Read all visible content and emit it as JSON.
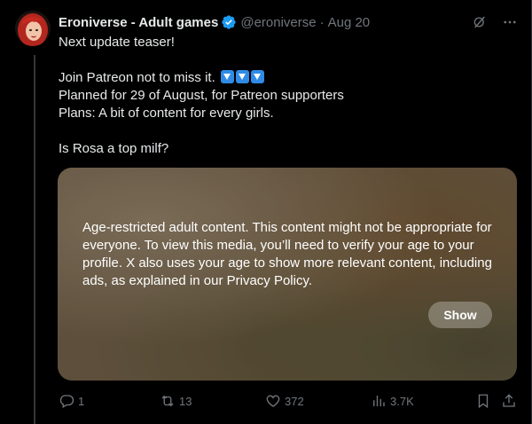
{
  "author": {
    "name": "Eroniverse - Adult games",
    "handle": "@eroniverse",
    "separator": "·",
    "date": "Aug 20"
  },
  "tweet": {
    "line1": "Next update teaser!",
    "line2": "Join Patreon not to miss it.",
    "line3": "Planned for 29 of August, for Patreon supporters",
    "line4": "Plans: A bit of content for every girls.",
    "line5": "Is Rosa a top milf?",
    "emoji": "down-arrow-button"
  },
  "media": {
    "warning": "Age-restricted adult content. This content might not be appropriate for everyone. To view this media, you’ll need to verify your age to your profile. X also uses your age to show more relevant content, including ads, as explained in our Privacy Policy.",
    "show_label": "Show"
  },
  "actions": {
    "replies": "1",
    "reposts": "13",
    "likes": "372",
    "views": "3.7K"
  },
  "colors": {
    "background": "#000000",
    "text": "#e7e9ea",
    "muted": "#71767b",
    "verified": "#1d9bf0"
  }
}
